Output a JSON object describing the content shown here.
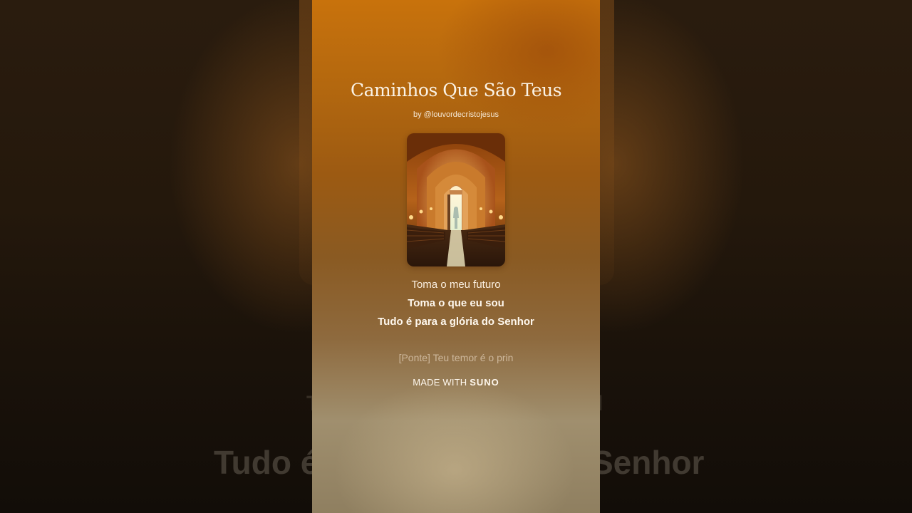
{
  "song": {
    "title": "Caminhos Que São Teus",
    "author": "by @louvordecristojesus"
  },
  "lyrics": {
    "previous_line": "Toma o meu futuro",
    "current_lines": [
      "Toma o que eu sou",
      "Tudo é para a glória do Senhor"
    ],
    "next_line": "[Ponte] Teu temor é o prin"
  },
  "branding": {
    "prefix": "MADE WITH",
    "brand": "SUNO"
  },
  "background": {
    "ghost_text": "Tudo é para a glória do Senhor"
  },
  "colors": {
    "accent": "#c8720c",
    "text": "#fff8ee"
  }
}
